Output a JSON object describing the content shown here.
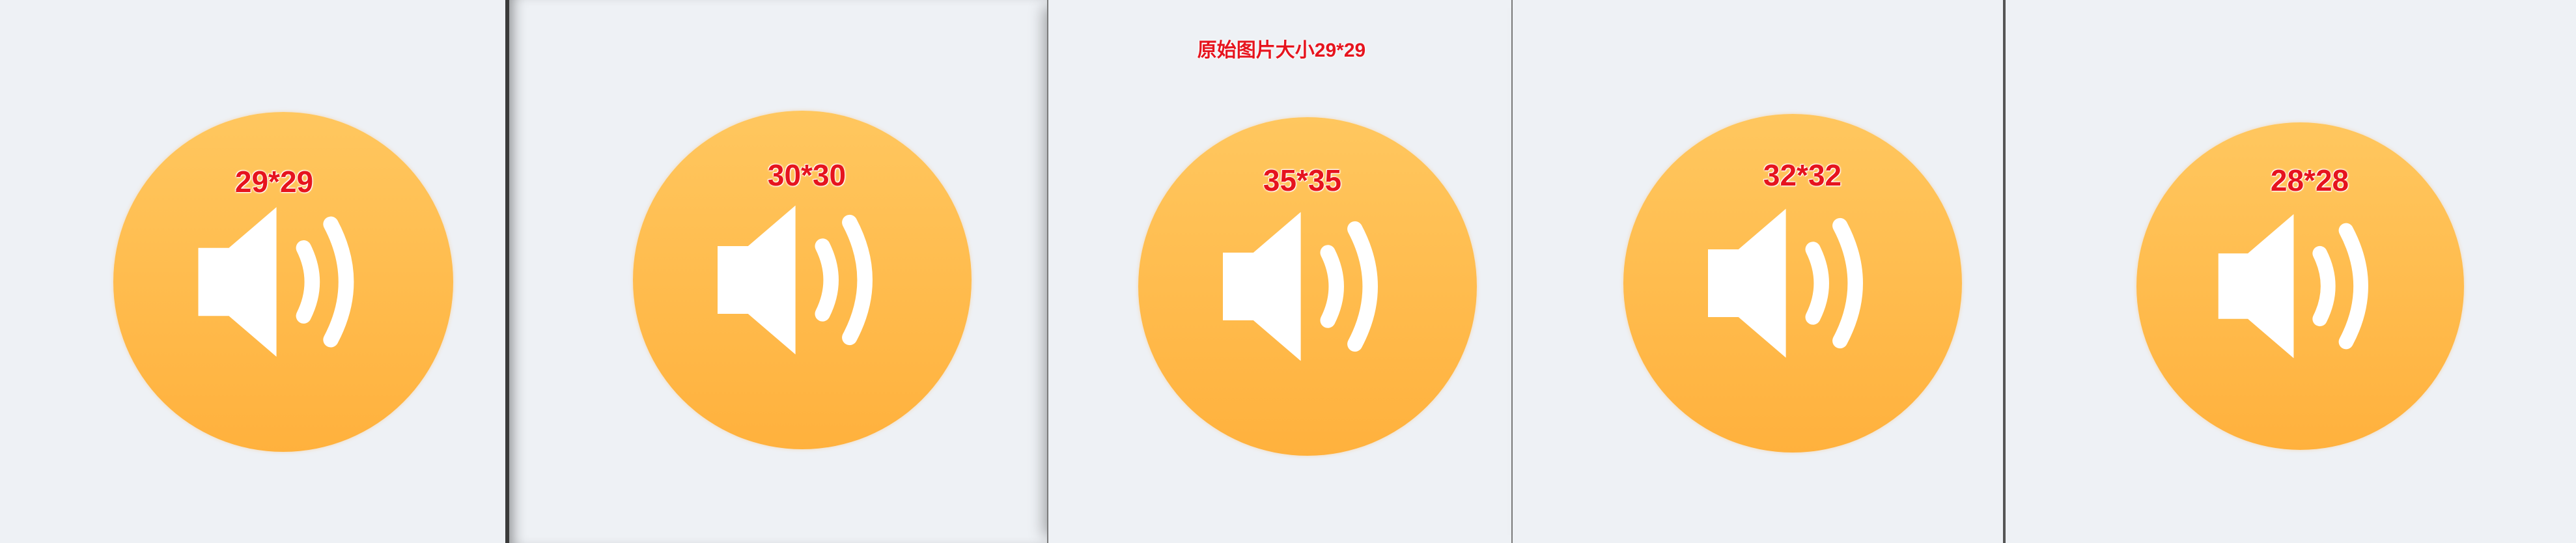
{
  "caption": "原始图片大小29*29",
  "icons": [
    {
      "label": "29*29",
      "icon": "speaker-volume-icon"
    },
    {
      "label": "30*30",
      "icon": "speaker-volume-icon"
    },
    {
      "label": "35*35",
      "icon": "speaker-volume-icon"
    },
    {
      "label": "32*32",
      "icon": "speaker-volume-icon"
    },
    {
      "label": "28*28",
      "icon": "speaker-volume-icon"
    }
  ],
  "colors": {
    "background": "#eef1f5",
    "icon_top": "#ffc75f",
    "icon_bottom": "#ffb13d",
    "label": "#e6141e",
    "glyph": "#ffffff"
  }
}
